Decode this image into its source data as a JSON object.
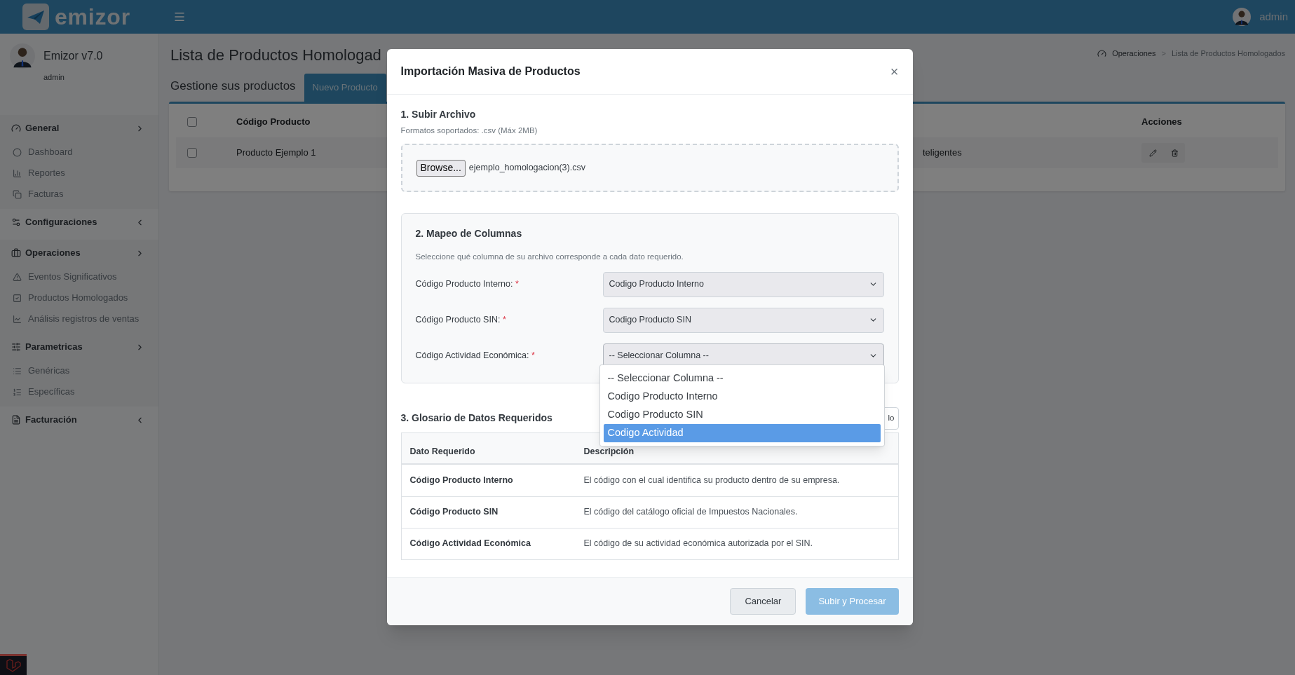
{
  "header": {
    "brand": "emizor",
    "user": "admin"
  },
  "sidebar": {
    "app_name": "Emizor v7.0",
    "user": "admin",
    "groups": [
      {
        "label": "General",
        "expanded": true,
        "children": [
          {
            "label": "Dashboard"
          },
          {
            "label": "Reportes"
          },
          {
            "label": "Facturas"
          }
        ]
      },
      {
        "label": "Configuraciones",
        "expanded": false
      },
      {
        "label": "Operaciones",
        "expanded": true,
        "children": [
          {
            "label": "Eventos Significativos"
          },
          {
            "label": "Productos Homologados"
          },
          {
            "label": "Análisis registros de ventas"
          }
        ]
      },
      {
        "label": "Parametricas",
        "expanded": true,
        "children": [
          {
            "label": "Genéricas"
          },
          {
            "label": "Específicas"
          }
        ]
      },
      {
        "label": "Facturación",
        "expanded": false
      }
    ]
  },
  "page": {
    "title": "Lista de Productos Homologad",
    "subtitle": "Gestione sus productos",
    "new_button": "Nuevo Producto",
    "breadcrumb": [
      "Operaciones",
      "Lista de Productos Homologados"
    ],
    "breadcrumb_separator": ">",
    "table": {
      "select_all": {
        "checked": false
      },
      "columns": [
        "Código Producto",
        "Acciones"
      ],
      "rows": [
        {
          "checked": false,
          "code": "Producto Ejemplo 1",
          "column_3": "teligentes"
        }
      ]
    }
  },
  "modal": {
    "title": "Importación Masiva de Productos",
    "close": "×",
    "upload": {
      "title": "1. Subir Archivo",
      "hint": "Formatos soportados: .csv (Máx 2MB)",
      "browse": "Browse...",
      "file_name": "ejemplo_homologacion(3).csv"
    },
    "mapping": {
      "title": "2. Mapeo de Columnas",
      "description": "Seleccione qué columna de su archivo corresponde a cada dato requerido.",
      "required_mark": "*",
      "fields": [
        {
          "label": "Código Producto Interno:",
          "required": true,
          "value": "Codigo Producto Interno",
          "expanded": false
        },
        {
          "label": "Código Producto SIN:",
          "required": true,
          "value": "Codigo Producto SIN",
          "expanded": false
        },
        {
          "label": "Código Actividad Económica:",
          "required": true,
          "value": "-- Seleccionar Columna --",
          "expanded": true
        }
      ],
      "options": [
        {
          "label": "-- Seleccionar Columna --",
          "selected": false
        },
        {
          "label": "Codigo Producto Interno",
          "selected": false
        },
        {
          "label": "Codigo Producto SIN",
          "selected": false
        },
        {
          "label": "Codigo Actividad",
          "selected": true
        }
      ]
    },
    "glossary": {
      "title": "3. Glosario de Datos Requeridos",
      "download_button": {
        "label": "lo",
        "disabled": false
      },
      "columns": [
        "Dato Requerido",
        "Descripción"
      ],
      "rows": [
        {
          "field": "Código Producto Interno",
          "description": "El código con el cual identifica su producto dentro de su empresa."
        },
        {
          "field": "Código Producto SIN",
          "description": "El código del catálogo oficial de Impuestos Nacionales."
        },
        {
          "field": "Código Actividad Económica",
          "description": "El código de su actividad económica autorizada por el SIN."
        }
      ]
    },
    "footer": {
      "cancel": "Cancelar",
      "submit": {
        "label": "Subir y Procesar",
        "disabled": true
      }
    }
  }
}
